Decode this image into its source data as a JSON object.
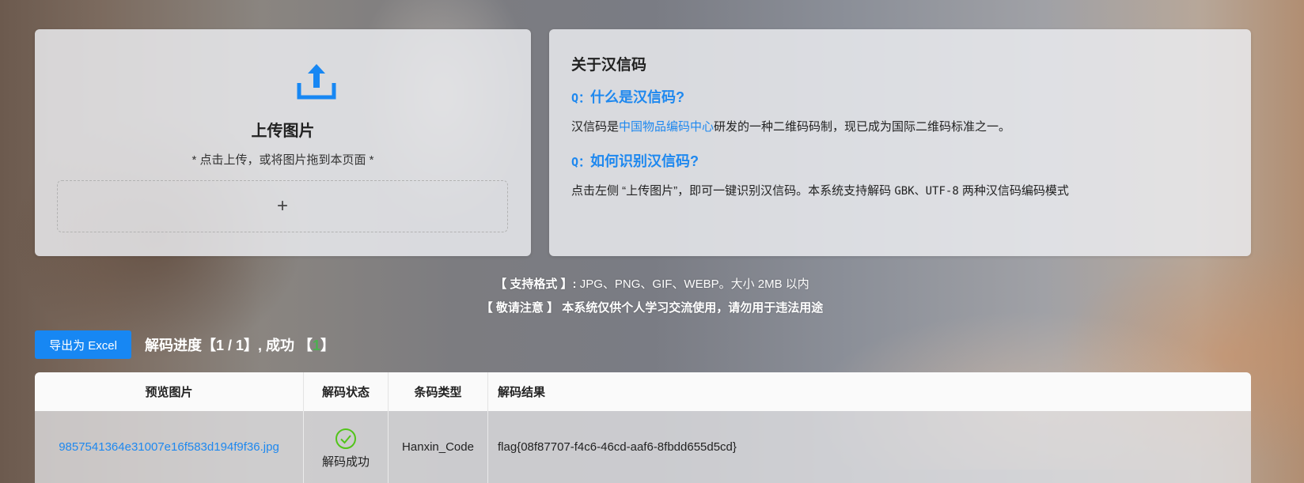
{
  "upload": {
    "icon": "upload-icon",
    "title": "上传图片",
    "hint": "* 点击上传，或将图片拖到本页面 *",
    "add_symbol": "+"
  },
  "about": {
    "title": "关于汉信码",
    "q_mark": "Q：",
    "q1": "什么是汉信码?",
    "a1_prefix": "汉信码是",
    "a1_link": "中国物品编码中心",
    "a1_suffix": "研发的一种二维码码制，现已成为国际二维码标准之一。",
    "q2": "如何识别汉信码?",
    "a2_prefix": "点击左侧 “上传图片”，即可一键识别汉信码。本系统支持解码 ",
    "a2_gbk": "GBK、UTF-8",
    "a2_suffix": " 两种汉信码编码模式"
  },
  "notice": {
    "formats_label": "【 支持格式 】:",
    "formats_value": " JPG、PNG、GIF、WEBP。大小 2MB 以内",
    "warning_label": "【 敬请注意 】",
    "warning_value": "本系统仅供个人学习交流使用，请勿用于违法用途"
  },
  "toolbar": {
    "export_label": "导出为 Excel",
    "progress_prefix": "解码进度【1 / 1】, 成功 【",
    "progress_success": "1",
    "progress_suffix": "】"
  },
  "table": {
    "headers": [
      "预览图片",
      "解码状态",
      "条码类型",
      "解码结果"
    ],
    "rows": [
      {
        "file": "9857541364e31007e16f583d194f9f36.jpg",
        "status_icon": "check-circle-icon",
        "status": "解码成功",
        "type": "Hanxin_Code",
        "result": "flag{08f87707-f4c6-46cd-aaf6-8fbdd655d5cd}"
      }
    ]
  },
  "colors": {
    "accent": "#1e88ef",
    "button": "#1787f3",
    "success": "#4caf50"
  }
}
